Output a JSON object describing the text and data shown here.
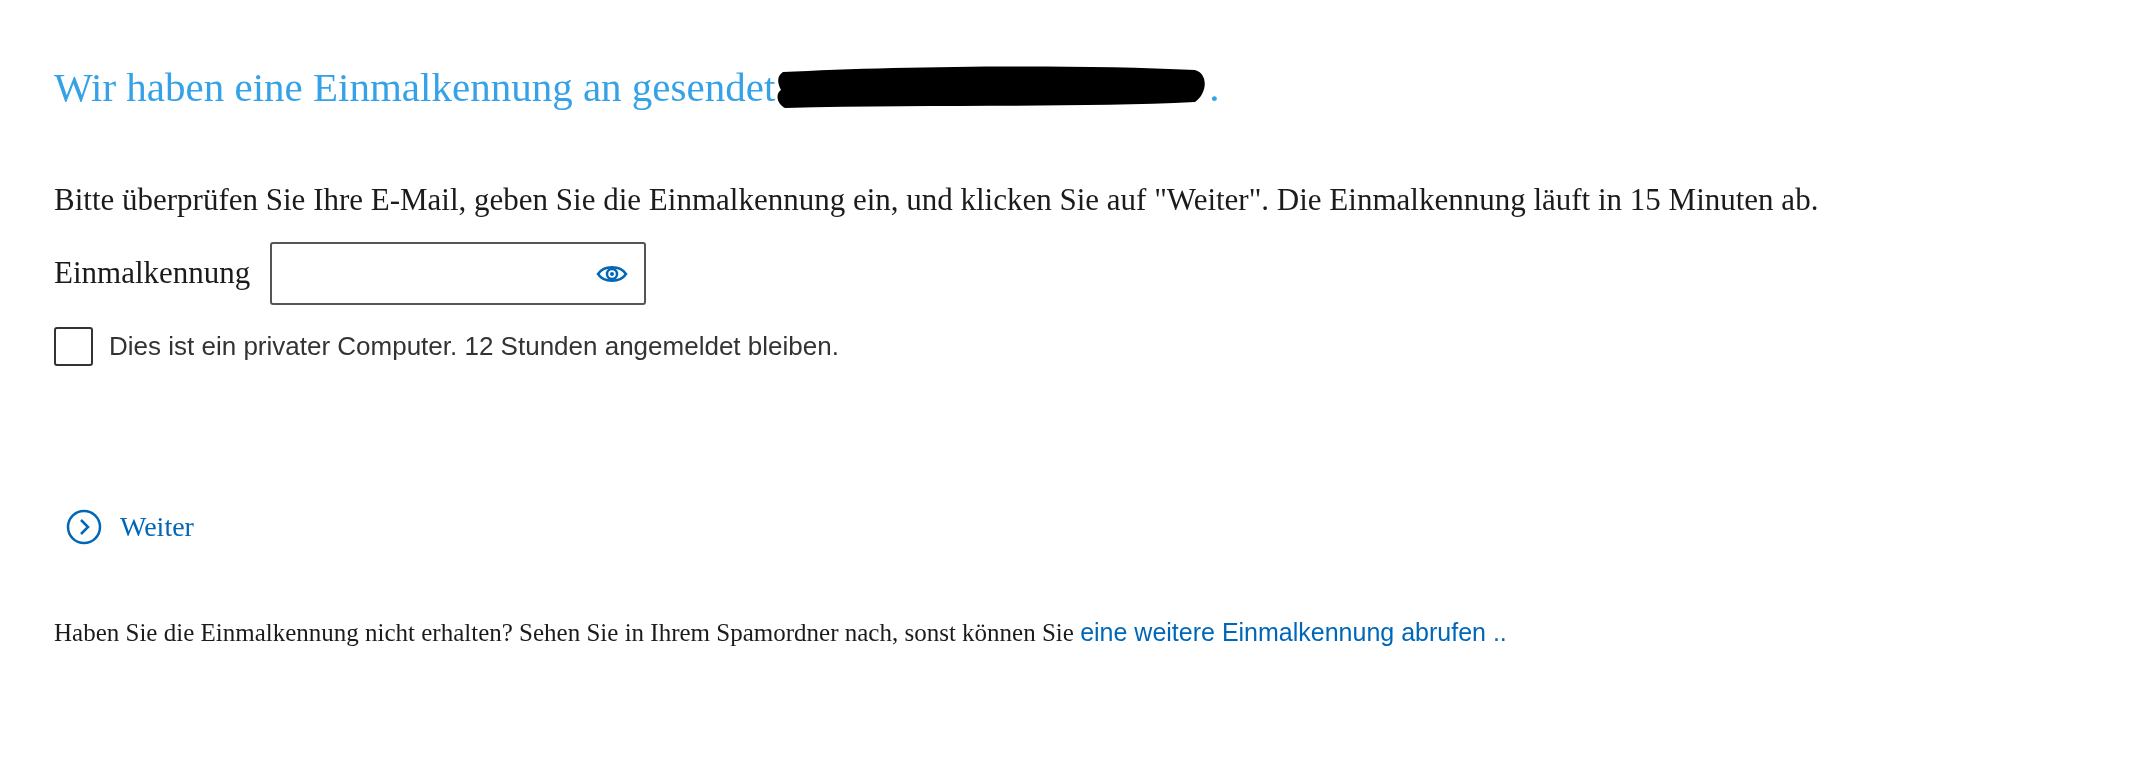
{
  "heading": {
    "text": "Wir haben eine Einmalkennung an gesendet",
    "end": "."
  },
  "instructions": "Bitte überprüfen Sie Ihre E-Mail, geben Sie die Einmalkennung ein, und klicken Sie auf \"Weiter\". Die Einmalkennung läuft in 15 Minuten ab.",
  "code_field": {
    "label": "Einmalkennung"
  },
  "remember": {
    "label": "Dies ist ein privater Computer. 12 Stunden angemeldet bleiben.",
    "checked": false
  },
  "next_button": {
    "label": "Weiter"
  },
  "help": {
    "text": "Haben Sie die Einmalkennung nicht erhalten? Sehen Sie in Ihrem Spamordner nach, sonst können Sie",
    "link": "eine weitere Einmalkennung abrufen .."
  }
}
